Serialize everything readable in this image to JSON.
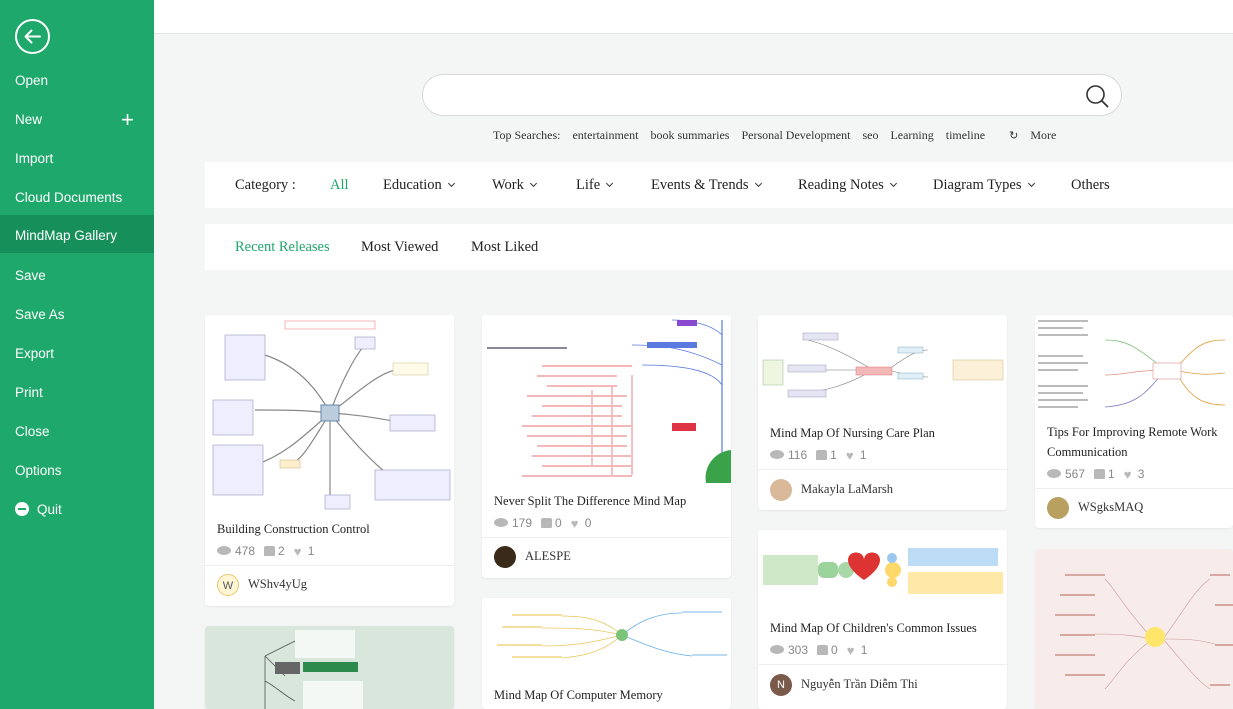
{
  "sidebar": {
    "items": [
      {
        "label": "Open"
      },
      {
        "label": "New"
      },
      {
        "label": "Import"
      },
      {
        "label": "Cloud Documents"
      },
      {
        "label": "MindMap Gallery"
      },
      {
        "label": "Save"
      },
      {
        "label": "Save As"
      },
      {
        "label": "Export"
      },
      {
        "label": "Print"
      },
      {
        "label": "Close"
      },
      {
        "label": "Options"
      },
      {
        "label": "Quit"
      }
    ],
    "active": "MindMap Gallery",
    "accent": "#1fa86b"
  },
  "search": {
    "placeholder": "",
    "top_label": "Top Searches:",
    "terms": [
      "entertainment",
      "book summaries",
      "Personal Development",
      "seo",
      "Learning",
      "timeline"
    ],
    "more_label": "More"
  },
  "category": {
    "label": "Category :",
    "items": [
      "All",
      "Education",
      "Work",
      "Life",
      "Events & Trends",
      "Reading Notes",
      "Diagram Types",
      "Others"
    ],
    "selected": "All"
  },
  "sort": {
    "tabs": [
      "Recent Releases",
      "Most Viewed",
      "Most Liked"
    ],
    "selected": "Recent Releases"
  },
  "cards": [
    {
      "title": "Building Construction Control",
      "views": "478",
      "likes": "2",
      "favorites": "1",
      "author": "WShv4yUg",
      "avatar_letter": "W"
    },
    {
      "title": "Never Split The Difference Mind Map",
      "views": "179",
      "likes": "0",
      "favorites": "0",
      "author": "ALESPE"
    },
    {
      "title": "Mind Map Of Nursing Care Plan",
      "views": "116",
      "likes": "1",
      "favorites": "1",
      "author": "Makayla LaMarsh"
    },
    {
      "title": "Tips For Improving Remote Work Communication",
      "views": "567",
      "likes": "1",
      "favorites": "3",
      "author": "WSgksMAQ"
    },
    {
      "title": "Mind Map Of Computer Memory"
    },
    {
      "title": "Mind Map Of Children's Common Issues",
      "views": "303",
      "likes": "0",
      "favorites": "1",
      "author": "Nguyễn Trần Diễm Thi",
      "avatar_letter": "N"
    }
  ]
}
